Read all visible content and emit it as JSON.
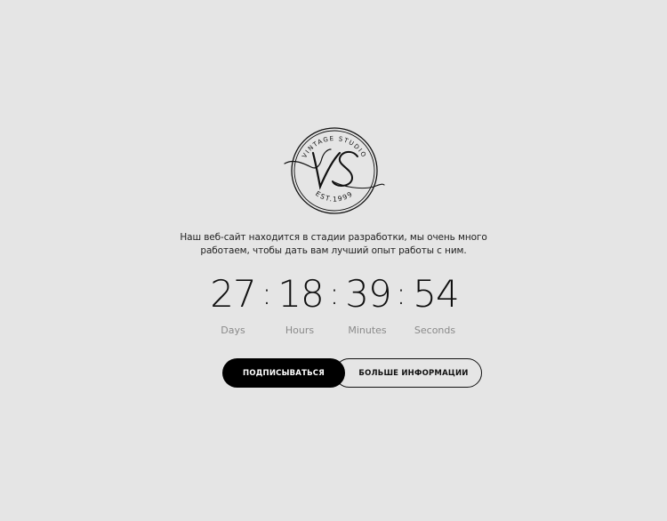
{
  "logo": {
    "top_text": "VINTAGE STUDIO",
    "monogram": "VS",
    "bottom_text": "EST.1999"
  },
  "description": {
    "line1": "Наш веб-сайт находится в стадии разработки, мы очень много",
    "line2": "работаем, чтобы дать вам лучший опыт работы с ним."
  },
  "countdown": {
    "separator": ":",
    "units": [
      {
        "value": "27",
        "label": "Days"
      },
      {
        "value": "18",
        "label": "Hours"
      },
      {
        "value": "39",
        "label": "Minutes"
      },
      {
        "value": "54",
        "label": "Seconds"
      }
    ]
  },
  "buttons": {
    "subscribe": "ПОДПИСЫВАТЬСЯ",
    "more_info": "БОЛЬШЕ ИНФОРМАЦИИ"
  },
  "colors": {
    "background": "#e5e5e5",
    "primary": "#000000",
    "label": "#8a8a8a"
  }
}
